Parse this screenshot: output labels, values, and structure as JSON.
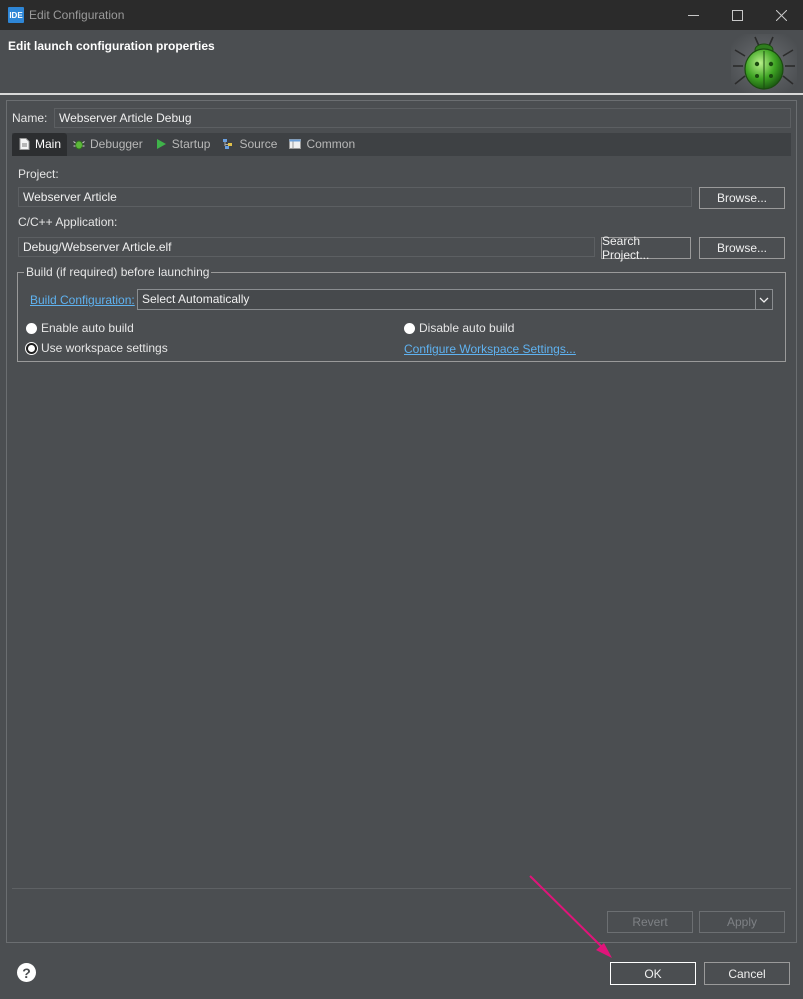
{
  "window": {
    "app_icon_text": "IDE",
    "title": "Edit Configuration",
    "minimize_icon": "minimize-icon",
    "maximize_icon": "maximize-icon",
    "close_icon": "close-icon"
  },
  "banner": {
    "title": "Edit launch configuration properties",
    "image_icon": "debug-bug-icon"
  },
  "name": {
    "label": "Name:",
    "value": "Webserver Article Debug"
  },
  "tabs": [
    {
      "label": "Main",
      "icon": "document-icon",
      "active": true
    },
    {
      "label": "Debugger",
      "icon": "bug-icon",
      "active": false
    },
    {
      "label": "Startup",
      "icon": "play-icon",
      "active": false
    },
    {
      "label": "Source",
      "icon": "source-icon",
      "active": false
    },
    {
      "label": "Common",
      "icon": "common-icon",
      "active": false
    }
  ],
  "main": {
    "project_label": "Project:",
    "project_value": "Webserver Article",
    "project_browse": "Browse...",
    "app_label": "C/C++ Application:",
    "app_value": "Debug/Webserver Article.elf",
    "search_project": "Search Project...",
    "app_browse": "Browse..."
  },
  "build": {
    "legend": "Build (if required) before launching",
    "config_link": "Build Configuration:",
    "config_value": "Select Automatically",
    "enable_auto": "Enable auto build",
    "disable_auto": "Disable auto build",
    "use_workspace": "Use workspace settings",
    "configure_link": "Configure Workspace Settings...",
    "selected_option": "Use workspace settings"
  },
  "actions": {
    "revert": "Revert",
    "apply": "Apply",
    "ok": "OK",
    "cancel": "Cancel",
    "help_icon": "help-icon"
  },
  "colors": {
    "background": "#4b4e51",
    "titlebar": "#2b2b2b",
    "link": "#5fb2f0",
    "arrow": "#e0147a"
  }
}
